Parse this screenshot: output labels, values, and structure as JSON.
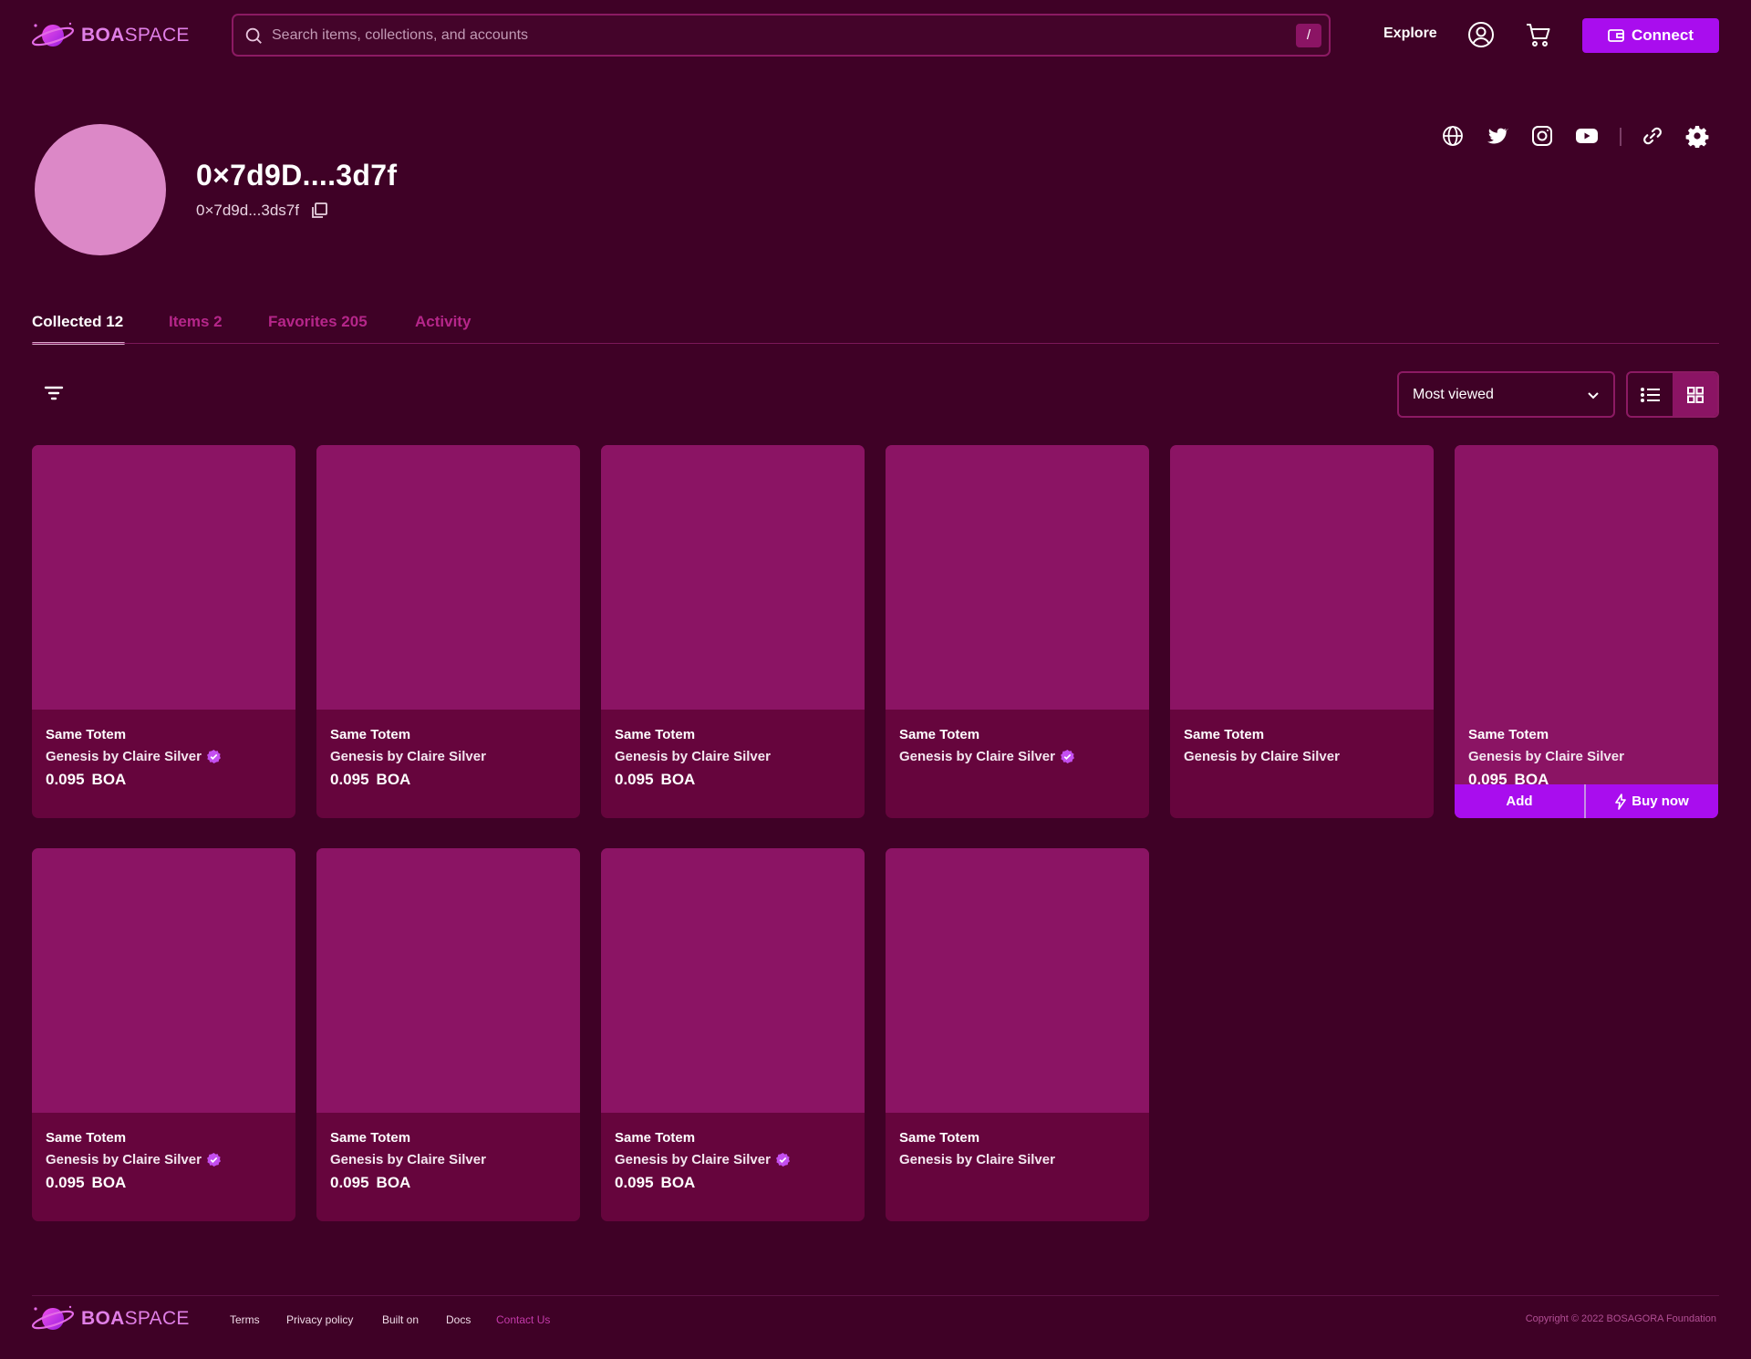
{
  "header": {
    "logo_bold": "BOA",
    "logo_light": "SPACE",
    "search_placeholder": "Search items, collections, and accounts",
    "search_shortcut": "/",
    "nav_explore": "Explore",
    "connect_label": "Connect"
  },
  "profile": {
    "name": "0×7d9D....3d7f",
    "address": "0×7d9d...3ds7f"
  },
  "tabs": [
    {
      "label": "Collected 12",
      "active": true
    },
    {
      "label": "Items 2",
      "active": false
    },
    {
      "label": "Favorites 205",
      "active": false
    },
    {
      "label": "Activity",
      "active": false
    }
  ],
  "toolbar": {
    "sort_value": "Most viewed",
    "view_mode": "grid"
  },
  "cards": [
    {
      "title": "Same Totem",
      "collection": "Genesis by Claire Silver",
      "verified": true,
      "price": "0.095",
      "currency": "BOA"
    },
    {
      "title": "Same Totem",
      "collection": "Genesis by Claire Silver",
      "verified": false,
      "price": "0.095",
      "currency": "BOA"
    },
    {
      "title": "Same Totem",
      "collection": "Genesis by Claire Silver",
      "verified": false,
      "price": "0.095",
      "currency": "BOA"
    },
    {
      "title": "Same Totem",
      "collection": "Genesis by Claire Silver",
      "verified": true,
      "price": "",
      "currency": ""
    },
    {
      "title": "Same Totem",
      "collection": "Genesis by Claire Silver",
      "verified": false,
      "price": "",
      "currency": ""
    },
    {
      "title": "Same Totem",
      "collection": "Genesis by Claire Silver",
      "verified": false,
      "price": "0.095",
      "currency": "BOA",
      "hovered": true,
      "add_label": "Add",
      "buy_label": "Buy now"
    },
    {
      "title": "Same Totem",
      "collection": "Genesis by Claire Silver",
      "verified": true,
      "price": "0.095",
      "currency": "BOA"
    },
    {
      "title": "Same Totem",
      "collection": "Genesis by Claire Silver",
      "verified": false,
      "price": "0.095",
      "currency": "BOA"
    },
    {
      "title": "Same Totem",
      "collection": "Genesis by Claire Silver",
      "verified": true,
      "price": "0.095",
      "currency": "BOA"
    },
    {
      "title": "Same Totem",
      "collection": "Genesis by Claire Silver",
      "verified": false,
      "price": "",
      "currency": ""
    }
  ],
  "footer": {
    "links": [
      "Terms",
      "Privacy policy",
      "Built on",
      "Docs",
      "Contact Us"
    ],
    "copyright": "Copyright © 2022 BOSAGORA Foundation"
  },
  "colors": {
    "background": "#3f0126",
    "card": "#66053d",
    "card_image": "#8b1464",
    "accent": "#a90dee",
    "verified": "#c44ff0"
  }
}
